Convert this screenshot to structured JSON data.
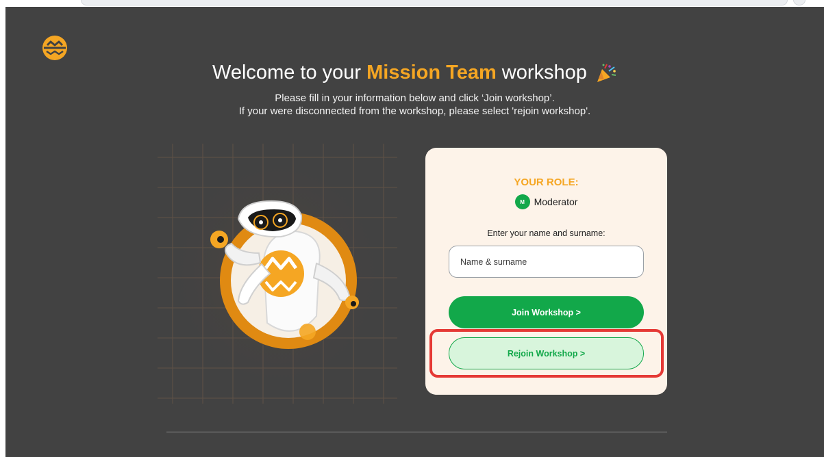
{
  "header": {
    "title_prefix": "Welcome to your ",
    "title_accent": "Mission Team",
    "title_suffix": " workshop",
    "subtitle_line1": "Please fill in your information below and click ‘Join workshop’.",
    "subtitle_line2": "If your were disconnected from the workshop, please select 'rejoin workshop'."
  },
  "role_card": {
    "heading": "YOUR ROLE:",
    "role_initial": "M",
    "role_name": "Moderator",
    "name_label": "Enter your name and surname:",
    "name_input": {
      "value": "",
      "placeholder": "Name & surname"
    },
    "join_button": "Join Workshop >",
    "rejoin_button": "Rejoin Workshop >"
  },
  "icons": {
    "logo": "mission-team-logo",
    "party": "party-popper-icon",
    "illustration": "robot-mascot-illustration"
  },
  "colors": {
    "background": "#424242",
    "accent_orange": "#f5a623",
    "primary_green": "#12a84a",
    "card_background": "#fdf3e9",
    "highlight_red": "#e53935"
  }
}
